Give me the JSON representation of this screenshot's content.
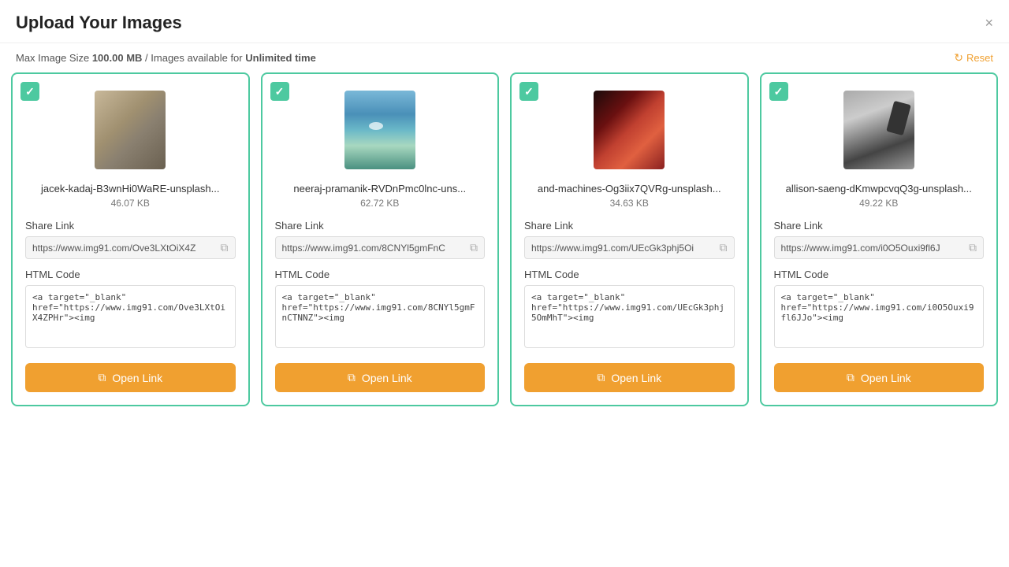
{
  "header": {
    "title": "Upload Your Images",
    "close_label": "×"
  },
  "info_bar": {
    "prefix": "Max Image Size ",
    "max_size": "100.00 MB",
    "separator": " / Images available for ",
    "availability": "Unlimited time"
  },
  "reset_button": {
    "label": "Reset"
  },
  "cards": [
    {
      "id": 1,
      "check": "✓",
      "img_class": "img-1",
      "file_name": "jacek-kadaj-B3wnHi0WaRE-unsplash...",
      "file_size": "46.07 KB",
      "share_link_label": "Share Link",
      "share_link_value": "https://www.img91.com/Ove3LXtOiX4Z",
      "html_code_label": "HTML Code",
      "html_code_value": "<a target=\"_blank\" href=\"https://www.img91.com/Ove3LXtOiX4ZPHr\"><img",
      "open_link_label": "Open Link"
    },
    {
      "id": 2,
      "check": "✓",
      "img_class": "img-2",
      "file_name": "neeraj-pramanik-RVDnPmc0lnc-uns...",
      "file_size": "62.72 KB",
      "share_link_label": "Share Link",
      "share_link_value": "https://www.img91.com/8CNYl5gmFnC",
      "html_code_label": "HTML Code",
      "html_code_value": "<a target=\"_blank\" href=\"https://www.img91.com/8CNYl5gmFnCTNNZ\"><img",
      "open_link_label": "Open Link"
    },
    {
      "id": 3,
      "check": "✓",
      "img_class": "img-3",
      "file_name": "and-machines-Og3iix7QVRg-unsplash...",
      "file_size": "34.63 KB",
      "share_link_label": "Share Link",
      "share_link_value": "https://www.img91.com/UEcGk3phj5Oi",
      "html_code_label": "HTML Code",
      "html_code_value": "<a target=\"_blank\" href=\"https://www.img91.com/UEcGk3phj5OmMhT\"><img",
      "open_link_label": "Open Link"
    },
    {
      "id": 4,
      "check": "✓",
      "img_class": "img-4",
      "file_name": "allison-saeng-dKmwpcvqQ3g-unsplash...",
      "file_size": "49.22 KB",
      "share_link_label": "Share Link",
      "share_link_value": "https://www.img91.com/i0O5Ouxi9fl6J",
      "html_code_label": "HTML Code",
      "html_code_value": "<a target=\"_blank\" href=\"https://www.img91.com/i0O5Ouxi9fl6JJo\"><img",
      "open_link_label": "Open Link"
    }
  ]
}
